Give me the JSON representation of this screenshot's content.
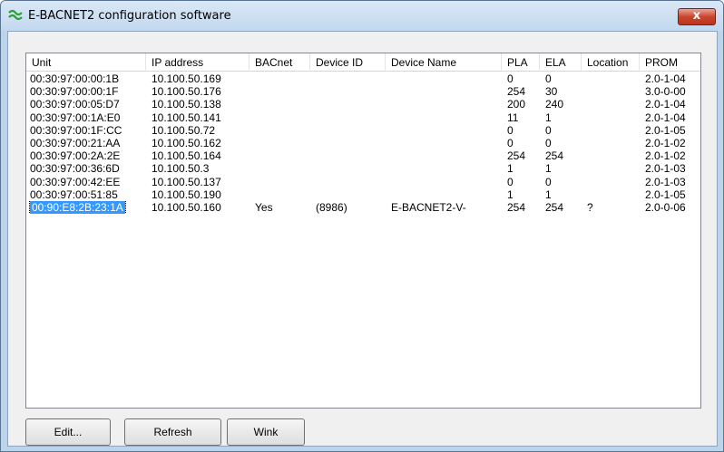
{
  "window": {
    "title": "E-BACNET2 configuration software",
    "close_label": "x"
  },
  "table": {
    "columns": [
      "Unit",
      "IP address",
      "BACnet",
      "Device ID",
      "Device Name",
      "PLA",
      "ELA",
      "Location",
      "PROM"
    ],
    "rows": [
      [
        "00:30:97:00:00:1B",
        "10.100.50.169",
        "",
        "",
        "",
        "0",
        "0",
        "",
        "2.0-1-04"
      ],
      [
        "00:30:97:00:00:1F",
        "10.100.50.176",
        "",
        "",
        "",
        "254",
        "30",
        "",
        "3.0-0-00"
      ],
      [
        "00:30:97:00:05:D7",
        "10.100.50.138",
        "",
        "",
        "",
        "200",
        "240",
        "",
        "2.0-1-04"
      ],
      [
        "00:30:97:00:1A:E0",
        "10.100.50.141",
        "",
        "",
        "",
        "11",
        "1",
        "",
        "2.0-1-04"
      ],
      [
        "00:30:97:00:1F:CC",
        "10.100.50.72",
        "",
        "",
        "",
        "0",
        "0",
        "",
        "2.0-1-05"
      ],
      [
        "00:30:97:00:21:AA",
        "10.100.50.162",
        "",
        "",
        "",
        "0",
        "0",
        "",
        "2.0-1-02"
      ],
      [
        "00:30:97:00:2A:2E",
        "10.100.50.164",
        "",
        "",
        "",
        "254",
        "254",
        "",
        "2.0-1-02"
      ],
      [
        "00:30:97:00:36:6D",
        "10.100.50.3",
        "",
        "",
        "",
        "1",
        "1",
        "",
        "2.0-1-03"
      ],
      [
        "00:30:97:00:42:EE",
        "10.100.50.137",
        "",
        "",
        "",
        "0",
        "0",
        "",
        "2.0-1-03"
      ],
      [
        "00:30:97:00:51:85",
        "10.100.50.190",
        "",
        "",
        "",
        "1",
        "1",
        "",
        "2.0-1-05"
      ],
      [
        "00:90:E8:2B:23:1A",
        "10.100.50.160",
        "Yes",
        "(8986)",
        "E-BACNET2-V-",
        "254",
        "254",
        "?",
        "2.0-0-06"
      ]
    ],
    "selected_row": 10
  },
  "buttons": {
    "edit": "Edit...",
    "refresh": "Refresh",
    "wink": "Wink"
  },
  "colors": {
    "selection": "#3399ff",
    "icon_green": "#2e9e3a"
  }
}
